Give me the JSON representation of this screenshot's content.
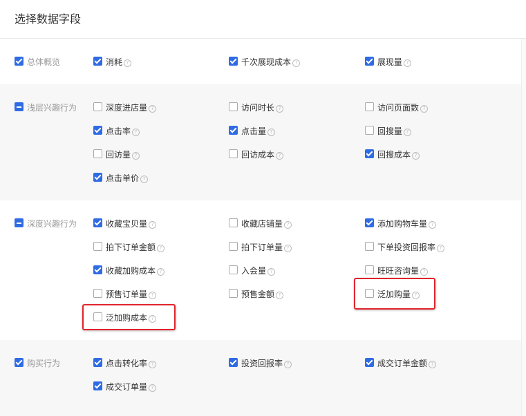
{
  "dialog": {
    "title": "选择数据字段"
  },
  "help_icon": "question-circle-icon",
  "accent_color": "#2f6be3",
  "highlight_color": "#e0242b",
  "groups": {
    "overview": {
      "label": "总体概览",
      "state": "checked",
      "fields": {
        "f1": {
          "label": "消耗",
          "checked": true
        },
        "f2": {
          "label": "千次展现成本",
          "checked": true
        },
        "f3": {
          "label": "展现量",
          "checked": true
        }
      }
    },
    "shallow": {
      "label": "浅层兴趣行为",
      "state": "partial",
      "fields": {
        "f1": {
          "label": "深度进店量",
          "checked": false
        },
        "f2": {
          "label": "访问时长",
          "checked": false
        },
        "f3": {
          "label": "访问页面数",
          "checked": false
        },
        "f4": {
          "label": "点击率",
          "checked": true
        },
        "f5": {
          "label": "点击量",
          "checked": true
        },
        "f6": {
          "label": "回搜量",
          "checked": false
        },
        "f7": {
          "label": "回访量",
          "checked": false
        },
        "f8": {
          "label": "回访成本",
          "checked": false
        },
        "f9": {
          "label": "回搜成本",
          "checked": true
        },
        "f10": {
          "label": "点击单价",
          "checked": true
        }
      }
    },
    "deep": {
      "label": "深度兴趣行为",
      "state": "partial",
      "fields": {
        "f1": {
          "label": "收藏宝贝量",
          "checked": true
        },
        "f2": {
          "label": "收藏店铺量",
          "checked": false
        },
        "f3": {
          "label": "添加购物车量",
          "checked": true
        },
        "f4": {
          "label": "拍下订单金额",
          "checked": false
        },
        "f5": {
          "label": "拍下订单量",
          "checked": false
        },
        "f6": {
          "label": "下单投资回报率",
          "checked": false
        },
        "f7": {
          "label": "收藏加购成本",
          "checked": true
        },
        "f8": {
          "label": "入会量",
          "checked": false
        },
        "f9": {
          "label": "旺旺咨询量",
          "checked": false
        },
        "f10": {
          "label": "预售订单量",
          "checked": false
        },
        "f11": {
          "label": "预售金额",
          "checked": false
        },
        "f12": {
          "label": "泛加购量",
          "checked": false
        },
        "f13": {
          "label": "泛加购成本",
          "checked": false
        }
      }
    },
    "purchase": {
      "label": "购买行为",
      "state": "checked",
      "fields": {
        "f1": {
          "label": "点击转化率",
          "checked": true
        },
        "f2": {
          "label": "投资回报率",
          "checked": true
        },
        "f3": {
          "label": "成交订单金额",
          "checked": true
        },
        "f4": {
          "label": "成交订单量",
          "checked": true
        }
      }
    }
  }
}
